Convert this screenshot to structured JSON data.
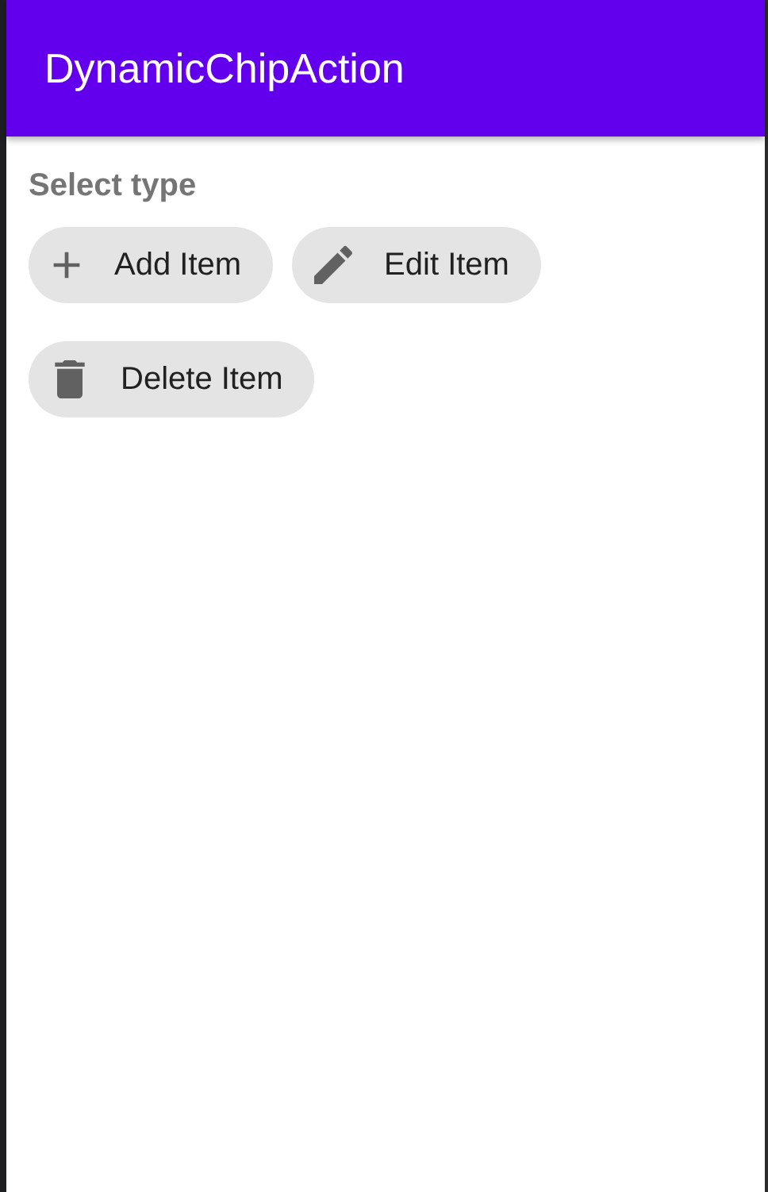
{
  "app_bar": {
    "title": "DynamicChipAction"
  },
  "section": {
    "label": "Select type"
  },
  "chips": [
    {
      "label": "Add Item",
      "kind": "add"
    },
    {
      "label": "Edit Item",
      "kind": "edit"
    },
    {
      "label": "Delete Item",
      "kind": "delete"
    }
  ]
}
